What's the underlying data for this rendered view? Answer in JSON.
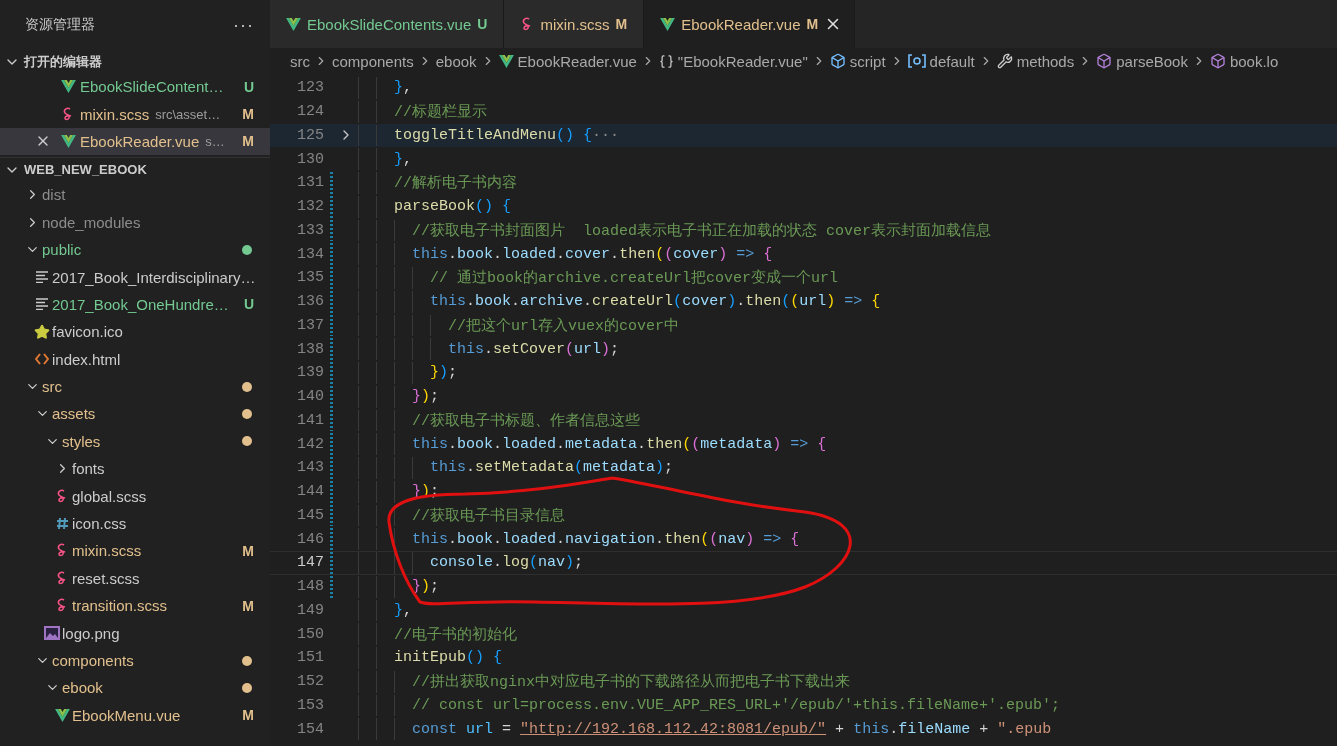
{
  "explorer": {
    "title": "资源管理器",
    "more": "···",
    "open_editors": {
      "title": "打开的编辑器",
      "expanded": true,
      "items": [
        {
          "name": "EbookSlideContent…",
          "kind": "vue",
          "color": "#73c991",
          "badge": "U",
          "selected": false
        },
        {
          "name": "mixin.scss",
          "description": "src\\asset…",
          "kind": "scss",
          "color": "#e2c08d",
          "badge": "M",
          "selected": false
        },
        {
          "name": "EbookReader.vue",
          "description": "s…",
          "kind": "vue",
          "color": "#e2c08d",
          "badge": "M",
          "selected": true
        }
      ]
    },
    "workspace": {
      "title": "WEB_NEW_EBOOK",
      "expanded": true,
      "tree": [
        {
          "name": "dist",
          "kind": "folder",
          "expanded": false,
          "color": "#8c8c8c"
        },
        {
          "name": "node_modules",
          "kind": "folder",
          "expanded": false,
          "color": "#8c8c8c"
        },
        {
          "name": "public",
          "kind": "folder",
          "expanded": true,
          "color": "#73c991",
          "dot": true,
          "children": [
            {
              "name": "2017_Book_Interdisciplinary…",
              "kind": "text"
            },
            {
              "name": "2017_Book_OneHundre…",
              "kind": "text",
              "color": "#73c991",
              "badge": "U"
            },
            {
              "name": "favicon.ico",
              "kind": "star"
            },
            {
              "name": "index.html",
              "kind": "html"
            }
          ]
        },
        {
          "name": "src",
          "kind": "folder",
          "expanded": true,
          "color": "#e2c08d",
          "dot": true,
          "children": [
            {
              "name": "assets",
              "kind": "folder",
              "expanded": true,
              "color": "#e2c08d",
              "dot": true,
              "children": [
                {
                  "name": "styles",
                  "kind": "folder",
                  "expanded": true,
                  "color": "#e2c08d",
                  "dot": true,
                  "children": [
                    {
                      "name": "fonts",
                      "kind": "folder",
                      "expanded": false
                    },
                    {
                      "name": "global.scss",
                      "kind": "scss"
                    },
                    {
                      "name": "icon.css",
                      "kind": "css"
                    },
                    {
                      "name": "mixin.scss",
                      "kind": "scss",
                      "color": "#e2c08d",
                      "badge": "M"
                    },
                    {
                      "name": "reset.scss",
                      "kind": "scss"
                    },
                    {
                      "name": "transition.scss",
                      "kind": "scss",
                      "color": "#e2c08d",
                      "badge": "M"
                    }
                  ]
                },
                {
                  "name": "logo.png",
                  "kind": "image"
                }
              ]
            },
            {
              "name": "components",
              "kind": "folder",
              "expanded": true,
              "color": "#e2c08d",
              "dot": true,
              "children": [
                {
                  "name": "ebook",
                  "kind": "folder",
                  "expanded": true,
                  "color": "#e2c08d",
                  "dot": true,
                  "children": [
                    {
                      "name": "EbookMenu.vue",
                      "kind": "vue",
                      "color": "#e2c08d",
                      "badge": "M"
                    }
                  ]
                }
              ]
            }
          ]
        }
      ]
    }
  },
  "tabs": [
    {
      "label": "EbookSlideContents.vue",
      "kind": "vue",
      "color": "#73c991",
      "badge": "U",
      "selected": false
    },
    {
      "label": "mixin.scss",
      "kind": "scss",
      "color": "#e2c08d",
      "badge": "M",
      "selected": false
    },
    {
      "label": "EbookReader.vue",
      "kind": "vue",
      "color": "#e2c08d",
      "badge": "M",
      "selected": true
    }
  ],
  "breadcrumbs": [
    {
      "label": "src",
      "kind": "plain"
    },
    {
      "label": "components",
      "kind": "plain"
    },
    {
      "label": "ebook",
      "kind": "plain"
    },
    {
      "label": "EbookReader.vue",
      "kind": "vue"
    },
    {
      "label": "\"EbookReader.vue\"",
      "kind": "braces"
    },
    {
      "label": "script",
      "kind": "field"
    },
    {
      "label": "default",
      "kind": "module"
    },
    {
      "label": "methods",
      "kind": "wrench"
    },
    {
      "label": "parseBook",
      "kind": "method"
    },
    {
      "label": "book.lo",
      "kind": "method"
    }
  ],
  "editor": {
    "lines": [
      {
        "number": "123",
        "folded": false,
        "current": false,
        "changed": false,
        "tokens": [
          {
            "text": "    }",
            "kind": "b3"
          },
          {
            "text": ",",
            "kind": "p"
          }
        ]
      },
      {
        "number": "124",
        "folded": false,
        "current": false,
        "changed": false,
        "tokens": [
          {
            "text": "    //标题栏显示",
            "kind": "c"
          }
        ]
      },
      {
        "number": "125",
        "folded": true,
        "current": false,
        "changed": false,
        "tokens": [
          {
            "text": "    toggleTitleAndMenu",
            "kind": "fn"
          },
          {
            "text": "() {",
            "kind": "b3"
          },
          {
            "text": "···",
            "kind": "fold"
          }
        ]
      },
      {
        "number": "130",
        "folded": false,
        "current": false,
        "changed": false,
        "tokens": [
          {
            "text": "    }",
            "kind": "b3"
          },
          {
            "text": ",",
            "kind": "p"
          }
        ]
      },
      {
        "number": "131",
        "folded": false,
        "current": false,
        "changed": true,
        "tokens": [
          {
            "text": "    //解析电子书内容",
            "kind": "c"
          }
        ]
      },
      {
        "number": "132",
        "folded": false,
        "current": false,
        "changed": true,
        "tokens": [
          {
            "text": "    parseBook",
            "kind": "fn"
          },
          {
            "text": "() {",
            "kind": "b3"
          }
        ]
      },
      {
        "number": "133",
        "folded": false,
        "current": false,
        "changed": true,
        "tokens": [
          {
            "text": "      //获取电子书封面图片  loaded表示电子书正在加载的状态 cover表示封面加载信息",
            "kind": "c"
          }
        ]
      },
      {
        "number": "134",
        "folded": false,
        "current": false,
        "changed": true,
        "tokens": [
          {
            "text": "      this",
            "kind": "kw"
          },
          {
            "text": ".",
            "kind": "p"
          },
          {
            "text": "book",
            "kind": "var"
          },
          {
            "text": ".",
            "kind": "p"
          },
          {
            "text": "loaded",
            "kind": "var"
          },
          {
            "text": ".",
            "kind": "p"
          },
          {
            "text": "cover",
            "kind": "var"
          },
          {
            "text": ".",
            "kind": "p"
          },
          {
            "text": "then",
            "kind": "fn"
          },
          {
            "text": "(",
            "kind": "b1"
          },
          {
            "text": "(",
            "kind": "b2"
          },
          {
            "text": "cover",
            "kind": "var"
          },
          {
            "text": ")",
            "kind": "b2"
          },
          {
            "text": " => ",
            "kind": "kw"
          },
          {
            "text": "{",
            "kind": "b2"
          }
        ]
      },
      {
        "number": "135",
        "folded": false,
        "current": false,
        "changed": true,
        "tokens": [
          {
            "text": "        // 通过book的archive.createUrl把cover变成一个url",
            "kind": "c"
          }
        ]
      },
      {
        "number": "136",
        "folded": false,
        "current": false,
        "changed": true,
        "tokens": [
          {
            "text": "        this",
            "kind": "kw"
          },
          {
            "text": ".",
            "kind": "p"
          },
          {
            "text": "book",
            "kind": "var"
          },
          {
            "text": ".",
            "kind": "p"
          },
          {
            "text": "archive",
            "kind": "var"
          },
          {
            "text": ".",
            "kind": "p"
          },
          {
            "text": "createUrl",
            "kind": "fn"
          },
          {
            "text": "(",
            "kind": "b3"
          },
          {
            "text": "cover",
            "kind": "var"
          },
          {
            "text": ")",
            "kind": "b3"
          },
          {
            "text": ".",
            "kind": "p"
          },
          {
            "text": "then",
            "kind": "fn"
          },
          {
            "text": "(",
            "kind": "b3"
          },
          {
            "text": "(",
            "kind": "b1"
          },
          {
            "text": "url",
            "kind": "var"
          },
          {
            "text": ")",
            "kind": "b1"
          },
          {
            "text": " => ",
            "kind": "kw"
          },
          {
            "text": "{",
            "kind": "b1"
          }
        ]
      },
      {
        "number": "137",
        "folded": false,
        "current": false,
        "changed": true,
        "tokens": [
          {
            "text": "          //把这个url存入vuex的cover中",
            "kind": "c"
          }
        ]
      },
      {
        "number": "138",
        "folded": false,
        "current": false,
        "changed": true,
        "tokens": [
          {
            "text": "          this",
            "kind": "kw"
          },
          {
            "text": ".",
            "kind": "p"
          },
          {
            "text": "setCover",
            "kind": "fn"
          },
          {
            "text": "(",
            "kind": "b2"
          },
          {
            "text": "url",
            "kind": "var"
          },
          {
            "text": ")",
            "kind": "b2"
          },
          {
            "text": ";",
            "kind": "p"
          }
        ]
      },
      {
        "number": "139",
        "folded": false,
        "current": false,
        "changed": true,
        "tokens": [
          {
            "text": "        }",
            "kind": "b1"
          },
          {
            "text": ")",
            "kind": "b3"
          },
          {
            "text": ";",
            "kind": "p"
          }
        ]
      },
      {
        "number": "140",
        "folded": false,
        "current": false,
        "changed": true,
        "tokens": [
          {
            "text": "      }",
            "kind": "b2"
          },
          {
            "text": ")",
            "kind": "b1"
          },
          {
            "text": ";",
            "kind": "p"
          }
        ]
      },
      {
        "number": "141",
        "folded": false,
        "current": false,
        "changed": true,
        "tokens": [
          {
            "text": "      //获取电子书标题、作者信息这些",
            "kind": "c"
          }
        ]
      },
      {
        "number": "142",
        "folded": false,
        "current": false,
        "changed": true,
        "tokens": [
          {
            "text": "      this",
            "kind": "kw"
          },
          {
            "text": ".",
            "kind": "p"
          },
          {
            "text": "book",
            "kind": "var"
          },
          {
            "text": ".",
            "kind": "p"
          },
          {
            "text": "loaded",
            "kind": "var"
          },
          {
            "text": ".",
            "kind": "p"
          },
          {
            "text": "metadata",
            "kind": "var"
          },
          {
            "text": ".",
            "kind": "p"
          },
          {
            "text": "then",
            "kind": "fn"
          },
          {
            "text": "(",
            "kind": "b1"
          },
          {
            "text": "(",
            "kind": "b2"
          },
          {
            "text": "metadata",
            "kind": "var"
          },
          {
            "text": ")",
            "kind": "b2"
          },
          {
            "text": " => ",
            "kind": "kw"
          },
          {
            "text": "{",
            "kind": "b2"
          }
        ]
      },
      {
        "number": "143",
        "folded": false,
        "current": false,
        "changed": true,
        "tokens": [
          {
            "text": "        this",
            "kind": "kw"
          },
          {
            "text": ".",
            "kind": "p"
          },
          {
            "text": "setMetadata",
            "kind": "fn"
          },
          {
            "text": "(",
            "kind": "b3"
          },
          {
            "text": "metadata",
            "kind": "var"
          },
          {
            "text": ")",
            "kind": "b3"
          },
          {
            "text": ";",
            "kind": "p"
          }
        ]
      },
      {
        "number": "144",
        "folded": false,
        "current": false,
        "changed": true,
        "tokens": [
          {
            "text": "      }",
            "kind": "b2"
          },
          {
            "text": ")",
            "kind": "b1"
          },
          {
            "text": ";",
            "kind": "p"
          }
        ]
      },
      {
        "number": "145",
        "folded": false,
        "current": false,
        "changed": true,
        "tokens": [
          {
            "text": "      //获取电子书目录信息",
            "kind": "c"
          }
        ]
      },
      {
        "number": "146",
        "folded": false,
        "current": false,
        "changed": true,
        "tokens": [
          {
            "text": "      this",
            "kind": "kw"
          },
          {
            "text": ".",
            "kind": "p"
          },
          {
            "text": "book",
            "kind": "var"
          },
          {
            "text": ".",
            "kind": "p"
          },
          {
            "text": "loaded",
            "kind": "var"
          },
          {
            "text": ".",
            "kind": "p"
          },
          {
            "text": "navigation",
            "kind": "var"
          },
          {
            "text": ".",
            "kind": "p"
          },
          {
            "text": "then",
            "kind": "fn"
          },
          {
            "text": "(",
            "kind": "b1"
          },
          {
            "text": "(",
            "kind": "b2"
          },
          {
            "text": "nav",
            "kind": "var"
          },
          {
            "text": ")",
            "kind": "b2"
          },
          {
            "text": " => ",
            "kind": "kw"
          },
          {
            "text": "{",
            "kind": "b2"
          }
        ]
      },
      {
        "number": "147",
        "folded": false,
        "current": true,
        "changed": true,
        "tokens": [
          {
            "text": "        console",
            "kind": "var"
          },
          {
            "text": ".",
            "kind": "p"
          },
          {
            "text": "log",
            "kind": "fn"
          },
          {
            "text": "(",
            "kind": "b3"
          },
          {
            "text": "nav",
            "kind": "var"
          },
          {
            "text": ")",
            "kind": "b3"
          },
          {
            "text": ";",
            "kind": "p"
          }
        ]
      },
      {
        "number": "148",
        "folded": false,
        "current": false,
        "changed": true,
        "tokens": [
          {
            "text": "      }",
            "kind": "b2"
          },
          {
            "text": ")",
            "kind": "b1"
          },
          {
            "text": ";",
            "kind": "p"
          }
        ]
      },
      {
        "number": "149",
        "folded": false,
        "current": false,
        "changed": false,
        "tokens": [
          {
            "text": "    }",
            "kind": "b3"
          },
          {
            "text": ",",
            "kind": "p"
          }
        ]
      },
      {
        "number": "150",
        "folded": false,
        "current": false,
        "changed": false,
        "tokens": [
          {
            "text": "    //电子书的初始化",
            "kind": "c"
          }
        ]
      },
      {
        "number": "151",
        "folded": false,
        "current": false,
        "changed": false,
        "tokens": [
          {
            "text": "    initEpub",
            "kind": "fn"
          },
          {
            "text": "() {",
            "kind": "b3"
          }
        ]
      },
      {
        "number": "152",
        "folded": false,
        "current": false,
        "changed": false,
        "tokens": [
          {
            "text": "      //拼出获取nginx中对应电子书的下载路径从而把电子书下载出来",
            "kind": "c"
          }
        ]
      },
      {
        "number": "153",
        "folded": false,
        "current": false,
        "changed": false,
        "tokens": [
          {
            "text": "      // const url=process.env.VUE_APP_RES_URL+'/epub/'+this.fileName+'.epub';",
            "kind": "c"
          }
        ]
      },
      {
        "number": "154",
        "folded": false,
        "current": false,
        "changed": false,
        "tokens": [
          {
            "text": "      const ",
            "kind": "kw"
          },
          {
            "text": "url",
            "kind": "const"
          },
          {
            "text": " = ",
            "kind": "p"
          },
          {
            "text": "\"http://192.168.112.42:8081/epub/\"",
            "kind": "link"
          },
          {
            "text": " + ",
            "kind": "p"
          },
          {
            "text": "this",
            "kind": "kw"
          },
          {
            "text": ".",
            "kind": "p"
          },
          {
            "text": "fileName",
            "kind": "var"
          },
          {
            "text": " + ",
            "kind": "p"
          },
          {
            "text": "\".epub",
            "kind": "str"
          }
        ]
      }
    ]
  }
}
